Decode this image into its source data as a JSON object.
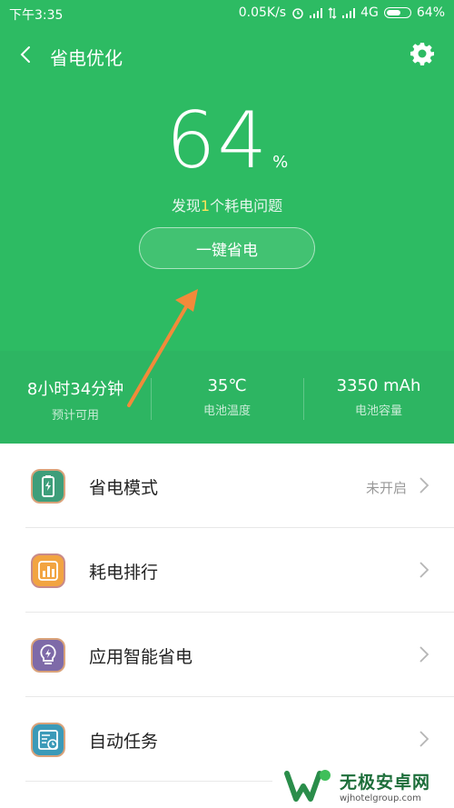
{
  "status_bar": {
    "time": "下午3:35",
    "speed": "0.05K/s",
    "network": "4G",
    "battery": "64%",
    "battery_level": 0.64
  },
  "header": {
    "title": "省电优化"
  },
  "hero": {
    "percent": "64",
    "unit": "%",
    "issues_prefix": "发现",
    "issues_count": "1",
    "issues_suffix": "个耗电问题",
    "button_label": "一键省电"
  },
  "stats": [
    {
      "value": "8小时34分钟",
      "label": "预计可用"
    },
    {
      "value": "35℃",
      "label": "电池温度"
    },
    {
      "value": "3350 mAh",
      "label": "电池容量"
    }
  ],
  "menu": [
    {
      "label": "省电模式",
      "status": "未开启",
      "icon": "battery-mode-icon",
      "color": "#3e9e7a"
    },
    {
      "label": "耗电排行",
      "status": "",
      "icon": "bar-chart-icon",
      "color": "#f2a441"
    },
    {
      "label": "应用智能省电",
      "status": "",
      "icon": "bulb-icon",
      "color": "#7e6aa8"
    },
    {
      "label": "自动任务",
      "status": "",
      "icon": "task-clock-icon",
      "color": "#3b9ab8"
    }
  ],
  "watermark": {
    "title": "无极安卓网",
    "url": "wjhotelgroup.com"
  },
  "colors": {
    "primary_green": "#2dbb63",
    "accent_arrow": "#f28a3a"
  }
}
